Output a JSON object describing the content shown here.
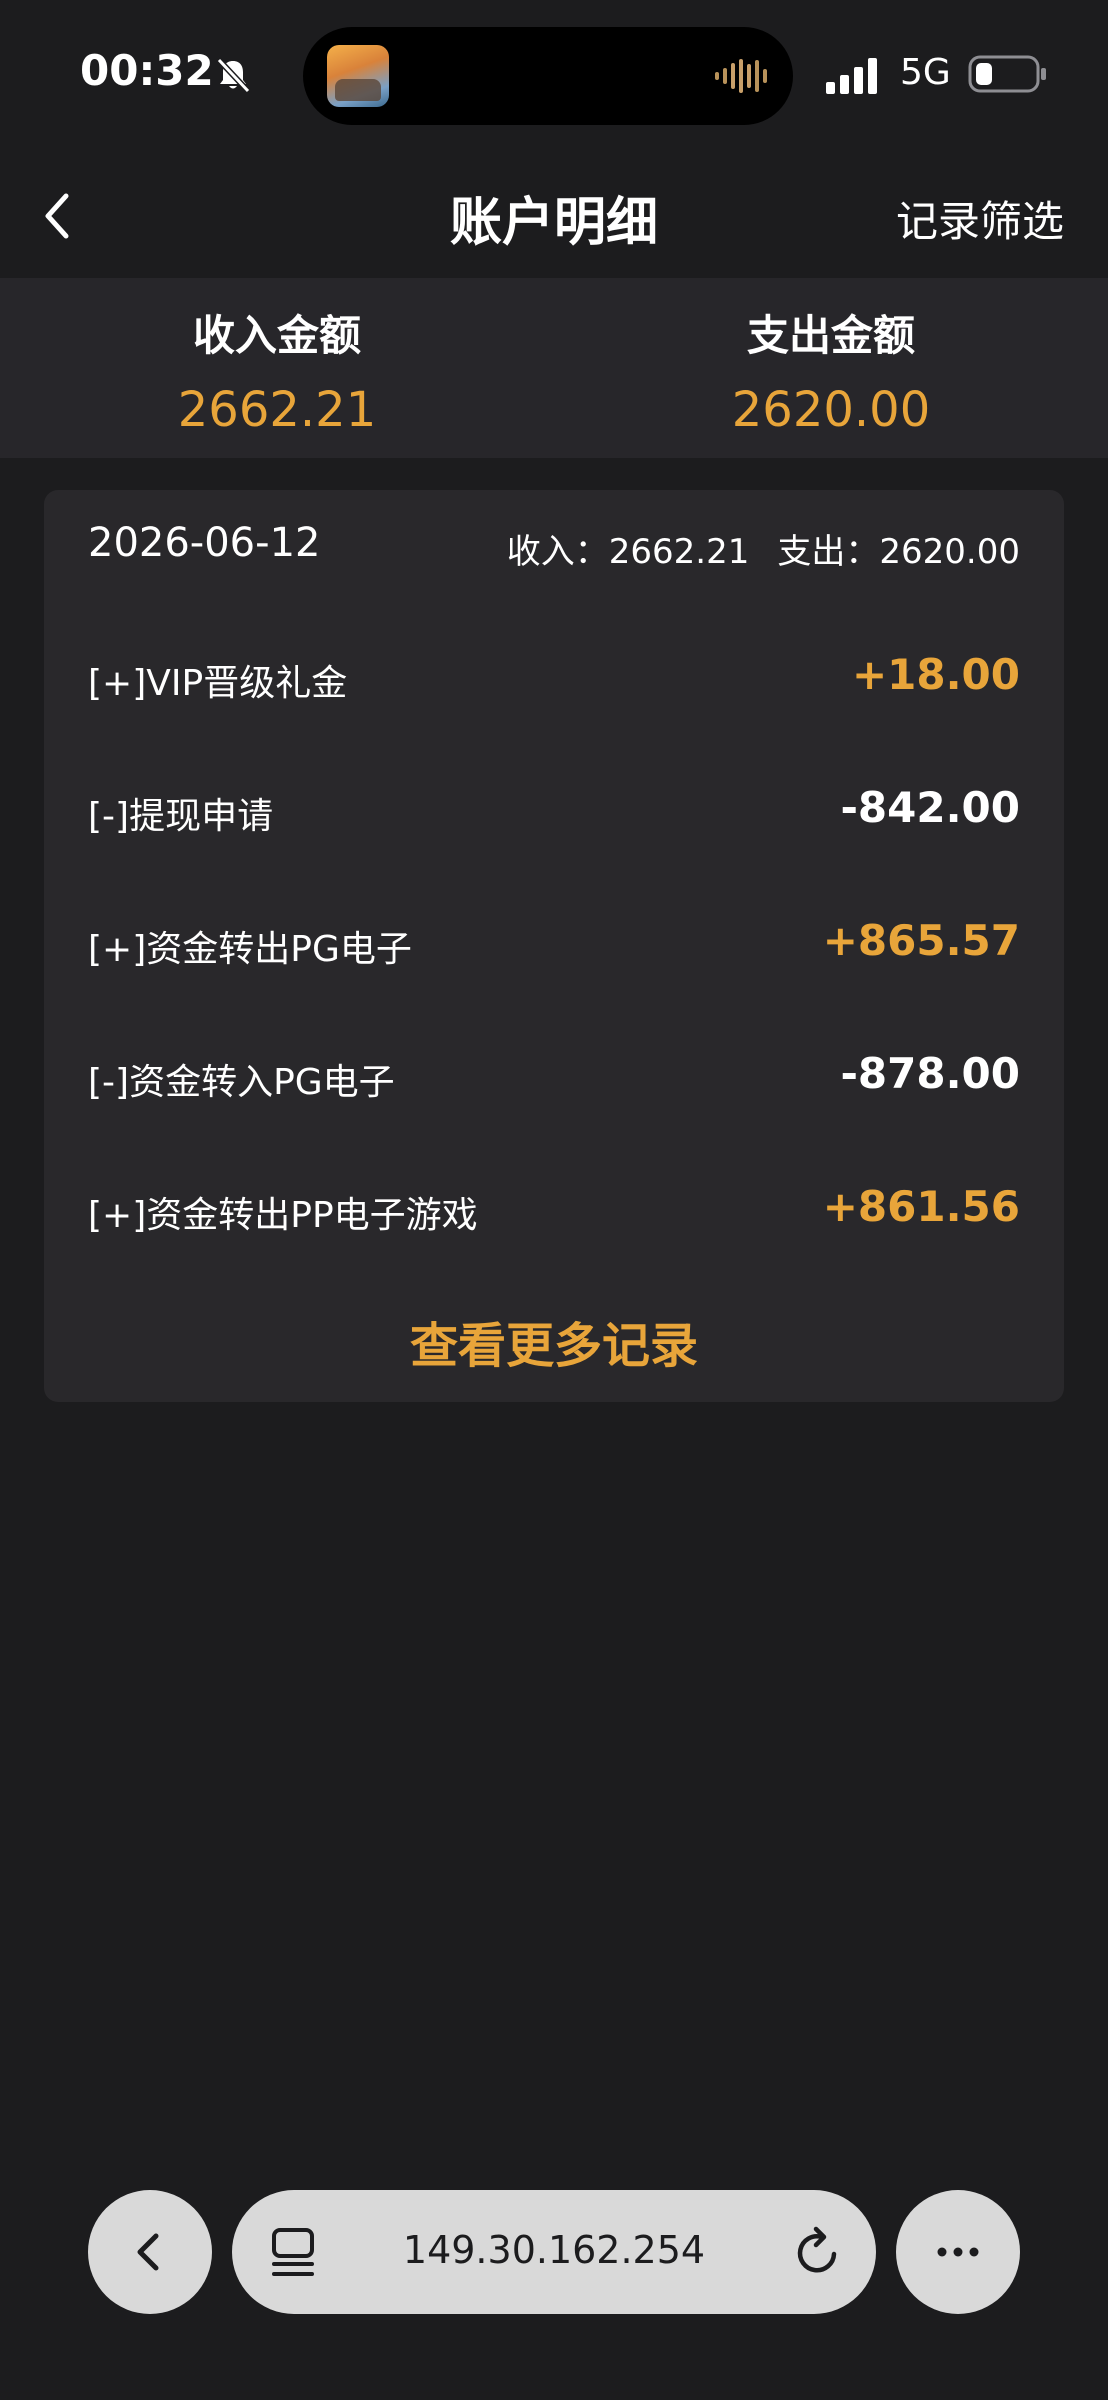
{
  "status_bar": {
    "time": "00:32",
    "network": "5G"
  },
  "nav": {
    "title": "账户明细",
    "filter_label": "记录筛选"
  },
  "summary": {
    "income_label": "收入金额",
    "income_value": "2662.21",
    "expense_label": "支出金额",
    "expense_value": "2620.00"
  },
  "card": {
    "date": "2026-06-12",
    "income_total": "收入：2662.21",
    "expense_total": "支出：2620.00",
    "records": [
      {
        "label": "[+]VIP晋级礼金",
        "amount": "+18.00",
        "type": "income"
      },
      {
        "label": "[-]提现申请",
        "amount": "-842.00",
        "type": "expense"
      },
      {
        "label": "[+]资金转出PG电子",
        "amount": "+865.57",
        "type": "income"
      },
      {
        "label": "[-]资金转入PG电子",
        "amount": "-878.00",
        "type": "expense"
      },
      {
        "label": "[+]资金转出PP电子游戏",
        "amount": "+861.56",
        "type": "income"
      }
    ],
    "more_label": "查看更多记录"
  },
  "browser": {
    "url": "149.30.162.254"
  },
  "icons": {
    "status": [
      "bell-slash-icon",
      "waveform-icon",
      "signal-icon",
      "battery-icon"
    ],
    "nav": [
      "chevron-left-icon"
    ],
    "browser": [
      "chevron-left-icon",
      "tabs-icon",
      "reload-icon",
      "more-icon"
    ]
  },
  "colors": {
    "background": "#1c1c1e",
    "summary_bg": "#27262a",
    "card_bg": "#29282b",
    "accent": "#e8a53a",
    "text": "#ffffff",
    "browser_bar": "#d9d9d9"
  }
}
